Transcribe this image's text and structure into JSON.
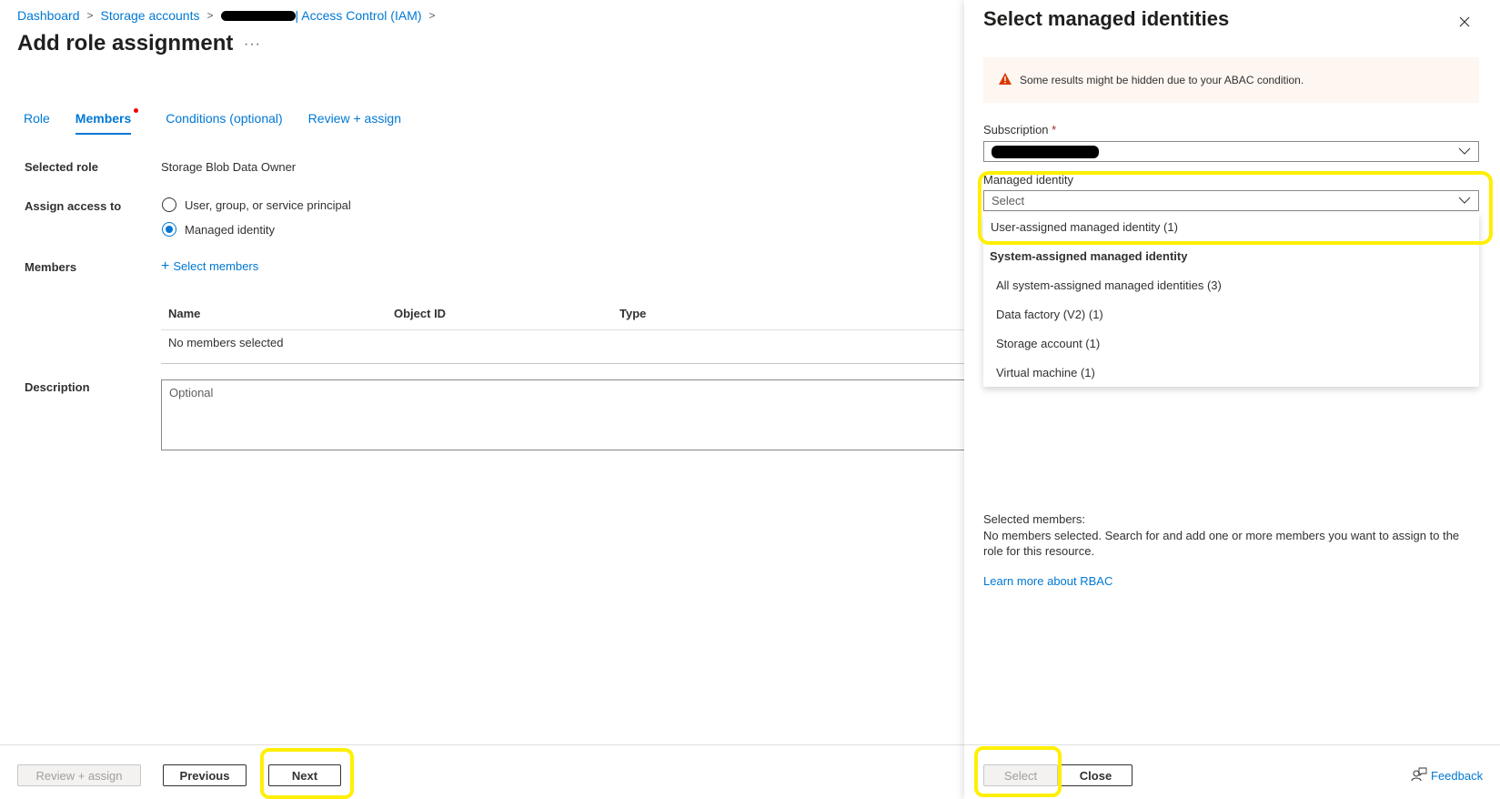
{
  "breadcrumb": {
    "items": [
      "Dashboard",
      "Storage accounts",
      "Access Control (IAM)"
    ],
    "redacted_prefix": "| Access Control (IAM)"
  },
  "page": {
    "title": "Add role assignment",
    "more_label": "···"
  },
  "tabs": [
    {
      "label": "Role",
      "active": false
    },
    {
      "label": "Members",
      "active": true,
      "has_indicator": true
    },
    {
      "label": "Conditions (optional)",
      "active": false
    },
    {
      "label": "Review + assign",
      "active": false
    }
  ],
  "form": {
    "selected_role_label": "Selected role",
    "selected_role_value": "Storage Blob Data Owner",
    "assign_access_label": "Assign access to",
    "assign_options": [
      {
        "label": "User, group, or service principal",
        "checked": false
      },
      {
        "label": "Managed identity",
        "checked": true
      }
    ],
    "members_label": "Members",
    "select_members_link": "Select members",
    "table": {
      "columns": [
        "Name",
        "Object ID",
        "Type"
      ],
      "empty_text": "No members selected"
    },
    "description_label": "Description",
    "description_placeholder": "Optional"
  },
  "footer": {
    "review_assign": "Review + assign",
    "previous": "Previous",
    "next": "Next"
  },
  "panel": {
    "title": "Select managed identities",
    "warning": "Some results might be hidden due to your ABAC condition.",
    "subscription_label": "Subscription",
    "required_mark": "*",
    "managed_identity_label": "Managed identity",
    "managed_identity_value": "Select",
    "menu": {
      "user_assigned": "User-assigned managed identity (1)",
      "system_header": "System-assigned managed identity",
      "system_items": [
        "All system-assigned managed identities (3)",
        "Data factory (V2) (1)",
        "Storage account (1)",
        "Virtual machine (1)"
      ]
    },
    "selected_members_label": "Selected members:",
    "selected_members_text": "No members selected. Search for and add one or more members you want to assign to the role for this resource.",
    "learn_more": "Learn more about RBAC",
    "select_button": "Select",
    "close_button": "Close",
    "feedback": "Feedback"
  },
  "colors": {
    "accent": "#0078d4",
    "highlight": "#ffef00",
    "warning_bg": "#fdf6f1",
    "warning_icon": "#d83b01"
  }
}
